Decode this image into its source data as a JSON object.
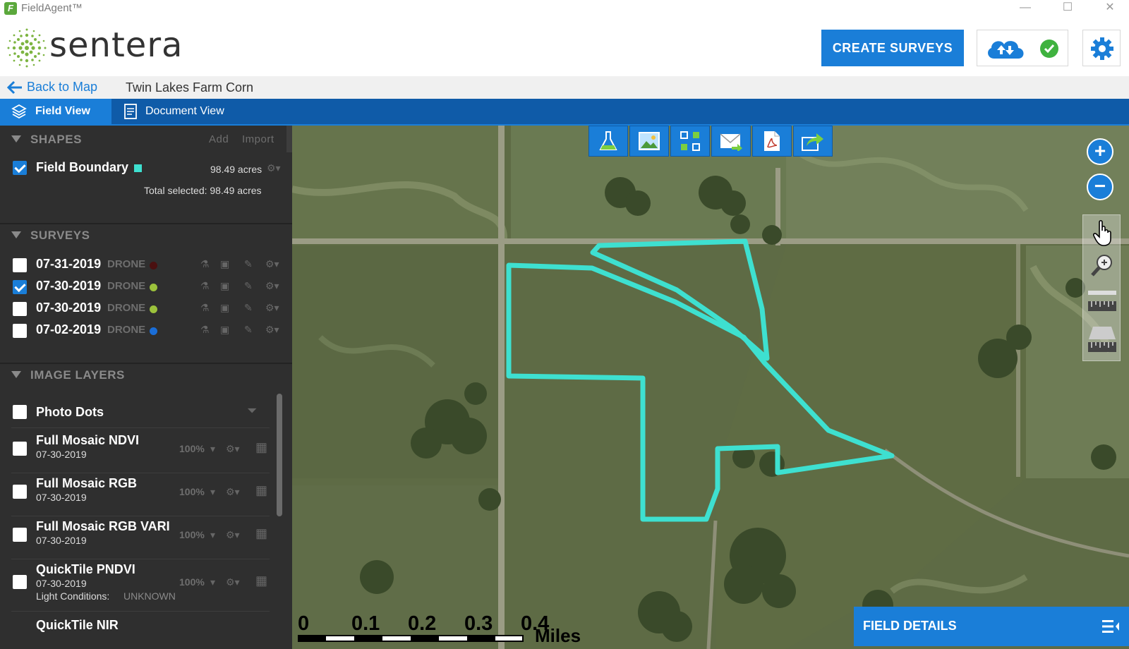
{
  "window": {
    "title": "FieldAgent™",
    "minimize": "—",
    "maximize": "☐",
    "close": "✕"
  },
  "header": {
    "logo_text": "sentera",
    "create_button": "CREATE SURVEYS",
    "sync_icon": "cloud-sync-icon",
    "status_icon": "check-circle-icon",
    "settings_icon": "gear-icon",
    "accent_color": "#1a7ed8"
  },
  "breadcrumb": {
    "back_label": "Back to Map",
    "title": "Twin Lakes Farm Corn"
  },
  "tabs": [
    {
      "label": "Field View",
      "active": true,
      "icon": "layers-icon"
    },
    {
      "label": "Document View",
      "active": false,
      "icon": "document-icon"
    }
  ],
  "shapes": {
    "heading": "SHAPES",
    "add_label": "Add",
    "import_label": "Import",
    "items": [
      {
        "name": "Field Boundary",
        "area": "98.49 acres",
        "checked": true,
        "color": "#3ee0d0"
      }
    ],
    "total": "Total selected: 98.49 acres"
  },
  "surveys": {
    "heading": "SURVEYS",
    "items": [
      {
        "date": "07-31-2019",
        "type": "DRONE",
        "color": "#4a1010",
        "checked": false
      },
      {
        "date": "07-30-2019",
        "type": "DRONE",
        "color": "#9cc23c",
        "checked": true
      },
      {
        "date": "07-30-2019",
        "type": "DRONE",
        "color": "#9cc23c",
        "checked": false
      },
      {
        "date": "07-02-2019",
        "type": "DRONE",
        "color": "#1a6ed8",
        "checked": false
      }
    ]
  },
  "image_layers": {
    "heading": "IMAGE LAYERS",
    "photo_dots": "Photo Dots",
    "items": [
      {
        "name": "Full Mosaic NDVI",
        "date": "07-30-2019",
        "opacity": "100%"
      },
      {
        "name": "Full Mosaic RGB",
        "date": "07-30-2019",
        "opacity": "100%"
      },
      {
        "name": "Full Mosaic RGB VARI",
        "date": "07-30-2019",
        "opacity": "100%"
      },
      {
        "name": "QuickTile PNDVI",
        "date": "07-30-2019",
        "opacity": "100%",
        "extra_label": "Light Conditions:",
        "extra_value": "UNKNOWN"
      }
    ],
    "last_item": "QuickTile NIR"
  },
  "map": {
    "toolbar_icons": [
      "flask-icon",
      "image-icon",
      "grid-compare-icon",
      "email-icon",
      "pdf-icon",
      "share-icon"
    ],
    "zoom_in": "+",
    "zoom_out": "−",
    "side_tools": [
      "pan-hand-icon",
      "zoom-magnifier-icon",
      "ruler-icon",
      "area-measure-icon"
    ],
    "scale_ticks": [
      "0",
      "0.1",
      "0.2",
      "0.3",
      "0.4"
    ],
    "scale_unit": "Miles",
    "field_details": "FIELD DETAILS",
    "boundary_color": "#3ee0d0"
  }
}
